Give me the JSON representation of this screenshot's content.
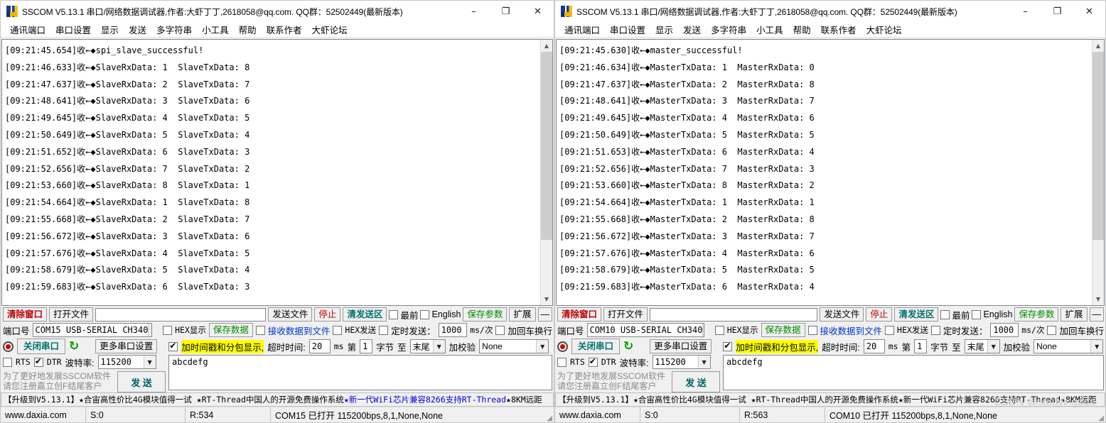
{
  "window": {
    "title": "SSCOM V5.13.1 串口/网络数据调试器,作者:大虾丁丁,2618058@qq.com. QQ群：52502449(最新版本)",
    "minimize": "–",
    "maximize": "❐",
    "close": "✕"
  },
  "menu": [
    "通讯端口",
    "串口设置",
    "显示",
    "发送",
    "多字符串",
    "小工具",
    "帮助",
    "联系作者",
    "大虾论坛"
  ],
  "toolbar": {
    "clear_window": "清除窗口",
    "open_file": "打开文件",
    "file_path_value": "",
    "send_file": "发送文件",
    "stop": "停止",
    "clear_send": "清发送区",
    "topmost": "最前",
    "english": "English",
    "save_params": "保存参数",
    "extend": "扩展",
    "collapse": "—"
  },
  "port_row": {
    "port_label": "端口号",
    "hex_display": "HEX显示",
    "save_data": "保存数据",
    "recv_to_file": "接收数据到文件",
    "hex_send": "HEX发送",
    "timed_send": "定时发送：",
    "interval_value": "1000",
    "interval_unit": "ms/次",
    "add_crlf": "加回车换行",
    "help_mark": "?"
  },
  "serial_row": {
    "close_port": "关闭串口",
    "more_settings": "更多串口设置",
    "timestamp_display": "加时间戳和分包显示,",
    "timeout_label": "超时时间:",
    "timeout_value": "20",
    "timeout_unit": "ms",
    "byte_prefix": "第",
    "byte_index": "1",
    "byte_label": "字节",
    "byte_to": "至",
    "byte_end": "末尾",
    "checksum_label": "加校验",
    "checksum_value": "None",
    "checksum_extra": ""
  },
  "baud_row": {
    "rts": "RTS",
    "dtr": "DTR",
    "baud_label": "波特率:",
    "baud_value": "115200"
  },
  "register_note": "为了更好地发展SSCOM软件\n请您注册嘉立创F结尾客户",
  "send_button": "发 送",
  "send_area_value": "abcdefg",
  "adbar": {
    "part1": "【升级到V5.13.1】★合宙高性价比4G模块值得一试 ★RT-Thread中国人的开源免费操作系统 ",
    "part2": "★新一代WiFi芯片兼容8266支持RT-Thread",
    "part3": " ★8KM远距"
  },
  "watermark": "CSDN @studyingdda",
  "panels": [
    {
      "id": "slave",
      "port_value": "COM15 USB-SERIAL CH340",
      "status": {
        "site": "www.daxia.com",
        "sent": "S:0",
        "recv": "R:534",
        "port_state": "COM15 已打开  115200bps,8,1,None,None"
      },
      "log": [
        "[09:21:45.654]收←◆spi_slave_successful!",
        "[09:21:46.633]收←◆SlaveRxData: 1  SlaveTxData: 8",
        "[09:21:47.637]收←◆SlaveRxData: 2  SlaveTxData: 7",
        "[09:21:48.641]收←◆SlaveRxData: 3  SlaveTxData: 6",
        "[09:21:49.645]收←◆SlaveRxData: 4  SlaveTxData: 5",
        "[09:21:50.649]收←◆SlaveRxData: 5  SlaveTxData: 4",
        "[09:21:51.652]收←◆SlaveRxData: 6  SlaveTxData: 3",
        "[09:21:52.656]收←◆SlaveRxData: 7  SlaveTxData: 2",
        "[09:21:53.660]收←◆SlaveRxData: 8  SlaveTxData: 1",
        "[09:21:54.664]收←◆SlaveRxData: 1  SlaveTxData: 8",
        "[09:21:55.668]收←◆SlaveRxData: 2  SlaveTxData: 7",
        "[09:21:56.672]收←◆SlaveRxData: 3  SlaveTxData: 6",
        "[09:21:57.676]收←◆SlaveRxData: 4  SlaveTxData: 5",
        "[09:21:58.679]收←◆SlaveRxData: 5  SlaveTxData: 4",
        "[09:21:59.683]收←◆SlaveRxData: 6  SlaveTxData: 3"
      ]
    },
    {
      "id": "master",
      "port_value": "COM10 USB-SERIAL CH340",
      "status": {
        "site": "www.daxia.com",
        "sent": "S:0",
        "recv": "R:563",
        "port_state": "COM10 已打开  115200bps,8,1,None,None"
      },
      "log": [
        "[09:21:45.630]收←◆master_successful!",
        "[09:21:46.634]收←◆MasterTxData: 1  MasterRxData: 0",
        "[09:21:47.637]收←◆MasterTxData: 2  MasterRxData: 8",
        "[09:21:48.641]收←◆MasterTxData: 3  MasterRxData: 7",
        "[09:21:49.645]收←◆MasterTxData: 4  MasterRxData: 6",
        "[09:21:50.649]收←◆MasterTxData: 5  MasterRxData: 5",
        "[09:21:51.653]收←◆MasterTxData: 6  MasterRxData: 4",
        "[09:21:52.656]收←◆MasterTxData: 7  MasterRxData: 3",
        "[09:21:53.660]收←◆MasterTxData: 8  MasterRxData: 2",
        "[09:21:54.664]收←◆MasterTxData: 1  MasterRxData: 1",
        "[09:21:55.668]收←◆MasterTxData: 2  MasterRxData: 8",
        "[09:21:56.672]收←◆MasterTxData: 3  MasterRxData: 7",
        "[09:21:57.676]收←◆MasterTxData: 4  MasterRxData: 6",
        "[09:21:58.679]收←◆MasterTxData: 5  MasterRxData: 5",
        "[09:21:59.683]收←◆MasterTxData: 6  MasterRxData: 4"
      ]
    }
  ]
}
